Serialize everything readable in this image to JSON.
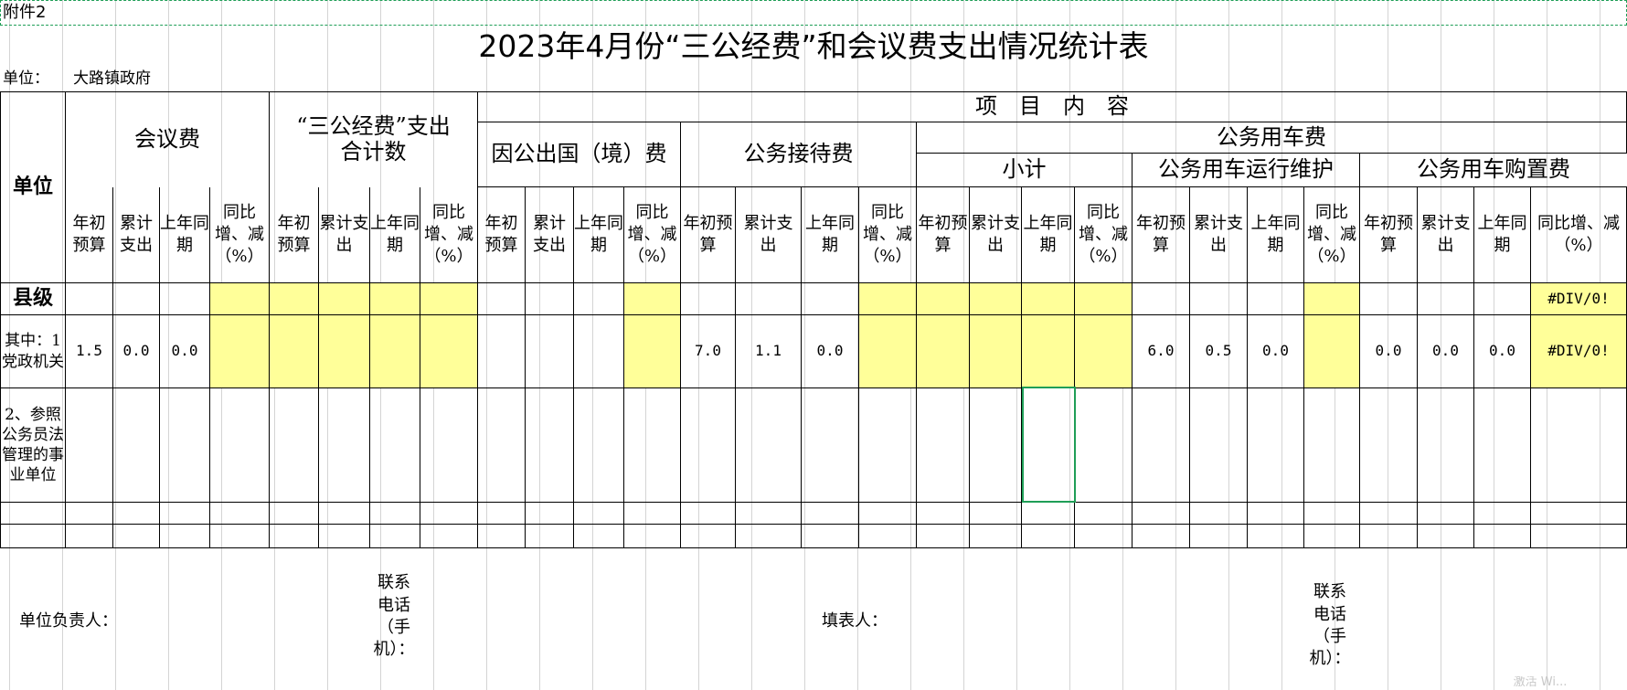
{
  "sheet": {
    "attachment": "附件2",
    "title": "2023年4月份“三公经费”和会议费支出情况统计表",
    "unit_label": "单位：",
    "unit_name": "大路镇政府",
    "watermark": "激活 Wi..."
  },
  "headers": {
    "unit": "单位",
    "meeting": "会议费",
    "sangong_total": "“三公经费”支出　　　合计数",
    "project_content": "项　目　内　容",
    "abroad": "因公出国（境）费",
    "reception": "公务接待费",
    "vehicle": "公务用车费",
    "subtotal": "小计",
    "vehicle_maint": "公务用车运行维护",
    "vehicle_purchase": "公务用车购置费",
    "col_budget": "年初预算",
    "col_spent": "累计支出",
    "col_prev": "上年同期",
    "col_yoy": "同比增、减（%）",
    "col_spent_alt": "累计支出",
    "col_yoy_alt": "同比增、减（%）"
  },
  "rows": {
    "county": {
      "label": "县级",
      "purchase_yoy": "#DIV/0!"
    },
    "party": {
      "label": "其中：1党政机关",
      "meeting": [
        "1.5",
        "0.0",
        "0.0"
      ],
      "reception": [
        "7.0",
        "1.1",
        "0.0"
      ],
      "maint": [
        "6.0",
        "0.5",
        "0.0"
      ],
      "purchase": [
        "0.0",
        "0.0",
        "0.0"
      ],
      "purchase_yoy": "#DIV/0!"
    },
    "institution": {
      "label": "2、参照公务员法管理的事业单位"
    }
  },
  "footer": {
    "head_label": "单位负责人：",
    "phone_label": "联系电话（手机）：",
    "filler_label": "填表人：",
    "phone_label2": "联系电话（手机）："
  }
}
